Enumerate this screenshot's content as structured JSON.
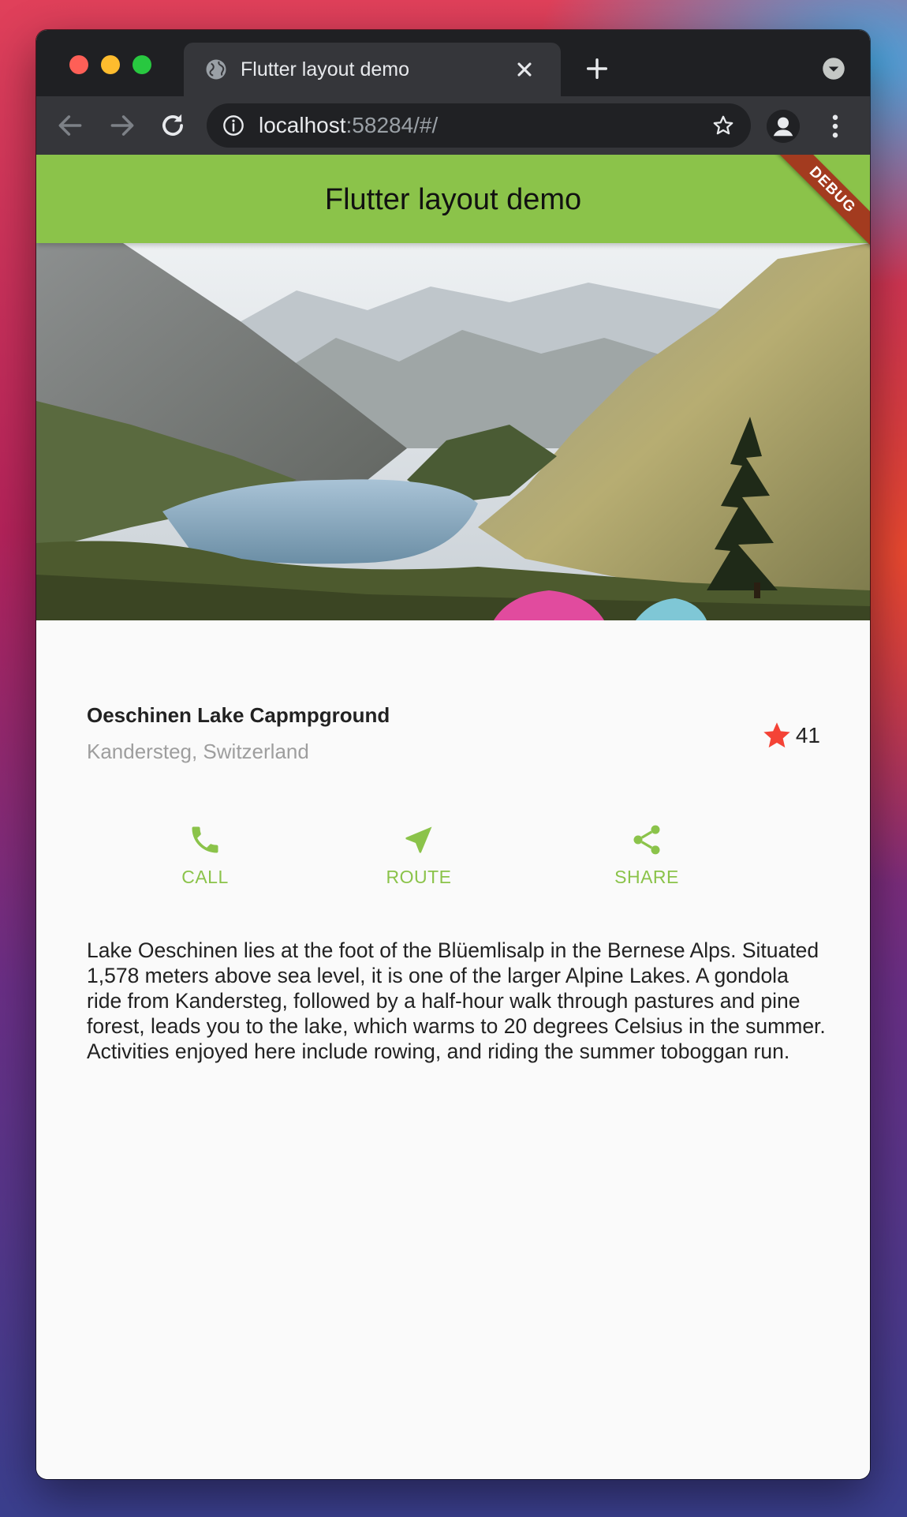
{
  "browser": {
    "tab_title": "Flutter layout demo",
    "url_host": "localhost",
    "url_rest": ":58284/#/"
  },
  "app": {
    "title": "Flutter layout demo",
    "debug_banner": "DEBUG",
    "place_name": "Oeschinen Lake Capmpground",
    "place_location": "Kandersteg, Switzerland",
    "rating_count": "41",
    "actions": [
      {
        "label": "CALL",
        "icon": "phone-icon"
      },
      {
        "label": "ROUTE",
        "icon": "near-me-icon"
      },
      {
        "label": "SHARE",
        "icon": "share-icon"
      }
    ],
    "description": "Lake Oeschinen lies at the foot of the Blüemlisalp in the Bernese Alps. Situated 1,578 meters above sea level, it is one of the larger Alpine Lakes. A gondola ride from Kandersteg, followed by a half-hour walk through pastures and pine forest, leads you to the lake, which warms to 20 degrees Celsius in the summer. Activities enjoyed here include rowing, and riding the summer toboggan run."
  },
  "colors": {
    "accent": "#8bc34a",
    "star": "#f44336",
    "debug": "#a33b1f"
  }
}
